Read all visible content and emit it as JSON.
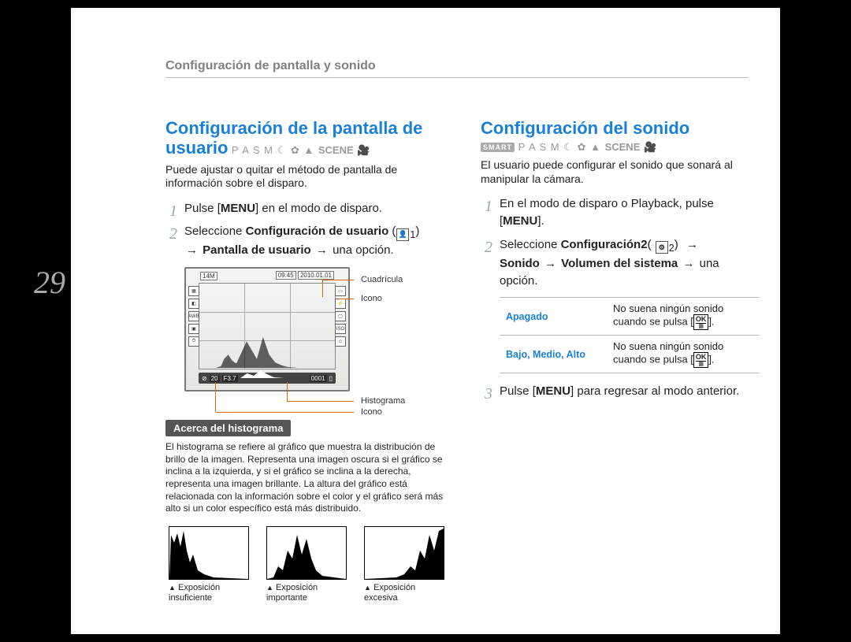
{
  "page_number": "29",
  "header": "Configuración de pantalla y sonido",
  "mode_line_left": "P A S M",
  "mode_line_scene": "SCENE",
  "left": {
    "title": "Configuración de la pantalla de usuario",
    "intro": "Puede ajustar o quitar el método de pantalla de información sobre el disparo.",
    "step1": "Pulse [MENU] en el modo de disparo.",
    "step2_a": "Seleccione ",
    "step2_b": "Configuración de usuario",
    "step2_sub": "1",
    "step2_c": "Pantalla de usuario",
    "step2_d": "una opción.",
    "cam": {
      "topleft": "14M",
      "time": "09:45",
      "date": "2010.01.01",
      "status_iso": "20",
      "status_f": "F3.7",
      "status_count": "0001"
    },
    "callout_grid": "Cuadrícula",
    "callout_icon": "Icono",
    "callout_hist": "Histograma",
    "callout_icon2": "Icono",
    "pill": "Acerca del histograma",
    "about": "El histograma se refiere al gráfico que muestra la distribución de brillo de la imagen. Representa una imagen oscura si el gráfico se inclina a la izquierda, y si el gráfico se inclina a la derecha, representa una imagen brillante. La altura del gráfico está relacionada con la información sobre el color y el gráfico será más alto si un color específico está más distribuido.",
    "hist_under": "Exposición insuficiente",
    "hist_mid": "Exposición importante",
    "hist_over": "Exposición excesiva"
  },
  "right": {
    "title": "Configuración del sonido",
    "intro": "El usuario puede configurar el sonido que sonará al manipular la cámara.",
    "step1": "En el modo de disparo o Playback, pulse [MENU].",
    "step2_a": "Seleccione ",
    "step2_b": "Configuración2",
    "step2_sub": "2",
    "step2_c": "Sonido",
    "step2_d": "Volumen del sistema",
    "step2_e": "una opción.",
    "table": {
      "k1": "Apagado",
      "v1": "No suena ningún sonido cuando se pulsa ",
      "k2": "Bajo, Medio, Alto",
      "v2": "No suena ningún sonido cuando se pulsa "
    },
    "step3": "Pulse [MENU] para regresar al modo anterior."
  },
  "ok_top": "OK",
  "ok_sub": "▦"
}
